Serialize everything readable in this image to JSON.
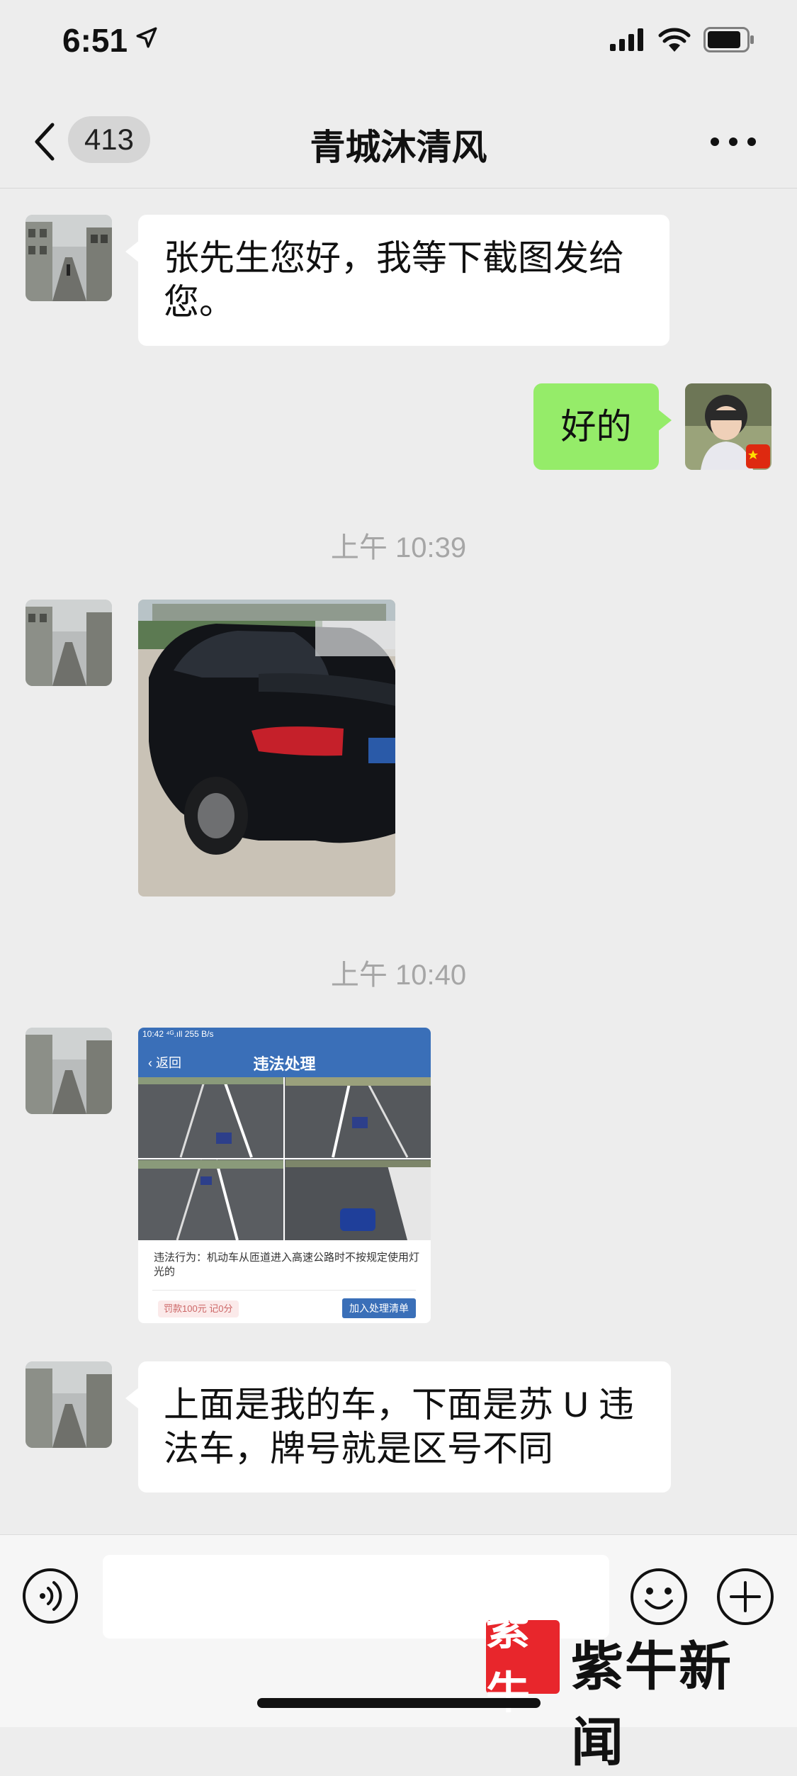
{
  "status": {
    "time": "6:51"
  },
  "nav": {
    "badge": "413",
    "title": "青城沐清风"
  },
  "messages": {
    "m1": "张先生您好，我等下截图发给您。",
    "m2": "好的",
    "ts1": "上午 10:39",
    "ts2": "上午 10:40",
    "m5": "上面是我的车，下面是苏 U 违法车，牌号就是区号不同"
  },
  "screenshot": {
    "status": "10:42 ⁴ᴳ.ıll 255 B/s",
    "back": "返回",
    "title": "违法处理",
    "violation": "违法行为：机动车从匝道进入高速公路时不按规定使用灯光的",
    "fine": "罚款100元 记0分",
    "add_btn": "加入处理清单"
  },
  "watermark": {
    "logo": "紫牛",
    "text": "紫牛新闻"
  },
  "colors": {
    "background": "#ededed",
    "bubble_in": "#ffffff",
    "bubble_out": "#95ec69",
    "accent": "#3a6fb8"
  }
}
